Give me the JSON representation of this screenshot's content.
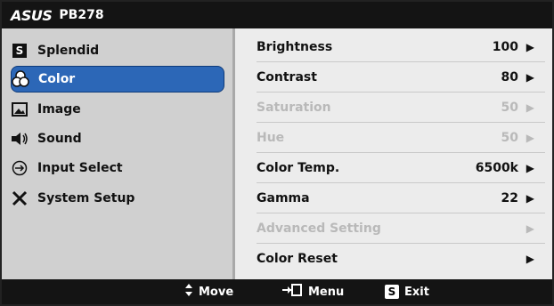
{
  "title": {
    "brand": "ASUS",
    "model": "PB278"
  },
  "sidebar": {
    "items": [
      {
        "label": "Splendid",
        "icon": "splendid-s-icon",
        "active": false
      },
      {
        "label": "Color",
        "icon": "color-palette-icon",
        "active": true
      },
      {
        "label": "Image",
        "icon": "image-icon",
        "active": false
      },
      {
        "label": "Sound",
        "icon": "speaker-icon",
        "active": false
      },
      {
        "label": "Input Select",
        "icon": "input-arrow-icon",
        "active": false
      },
      {
        "label": "System Setup",
        "icon": "tools-icon",
        "active": false
      }
    ]
  },
  "content": {
    "rows": [
      {
        "label": "Brightness",
        "value": "100",
        "enabled": true
      },
      {
        "label": "Contrast",
        "value": "80",
        "enabled": true
      },
      {
        "label": "Saturation",
        "value": "50",
        "enabled": false
      },
      {
        "label": "Hue",
        "value": "50",
        "enabled": false
      },
      {
        "label": "Color Temp.",
        "value": "6500k",
        "enabled": true
      },
      {
        "label": "Gamma",
        "value": "22",
        "enabled": true
      },
      {
        "label": "Advanced Setting",
        "value": "",
        "enabled": false
      },
      {
        "label": "Color Reset",
        "value": "",
        "enabled": true
      }
    ]
  },
  "footer": {
    "move": "Move",
    "menu": "Menu",
    "exit": "Exit",
    "exit_key": "S"
  },
  "colors": {
    "active_bg": "#2c67b7",
    "disabled_text": "#b9b9b9"
  }
}
